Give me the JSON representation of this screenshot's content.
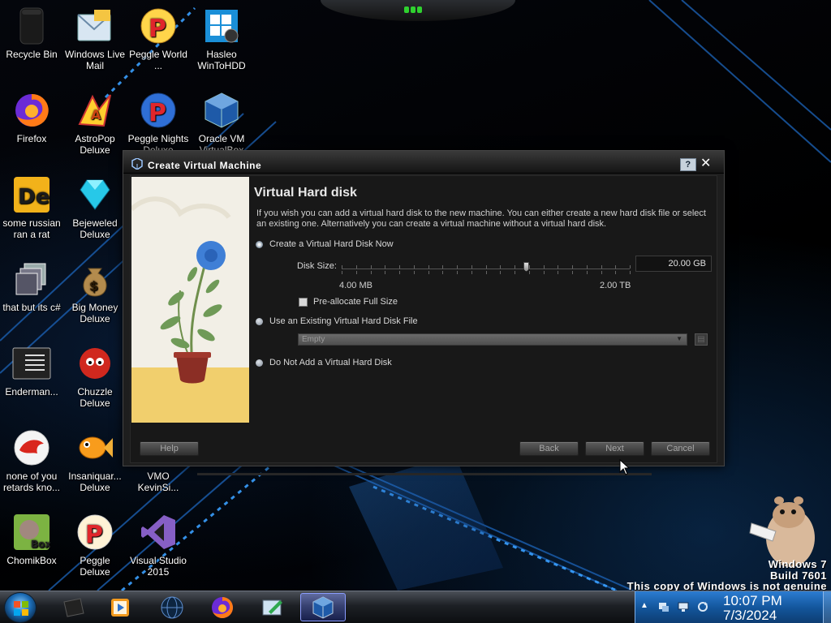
{
  "desktop": {
    "icons": [
      {
        "label": "Recycle Bin"
      },
      {
        "label": "Windows Live Mail"
      },
      {
        "label": "Peggle World ..."
      },
      {
        "label": "Hasleo WinToHDD"
      },
      {
        "label": "Firefox"
      },
      {
        "label": "AstroPop Deluxe"
      },
      {
        "label": "Peggle Nights Deluxe"
      },
      {
        "label": "Oracle VM VirtualBox"
      },
      {
        "label": "some russian ran a rat"
      },
      {
        "label": "Bejeweled Deluxe"
      },
      {
        "label": "that but its c#"
      },
      {
        "label": "Big Money Deluxe"
      },
      {
        "label": "Enderman..."
      },
      {
        "label": "Chuzzle Deluxe"
      },
      {
        "label": "none of you retards kno..."
      },
      {
        "label": "Insaniquar... Deluxe"
      },
      {
        "label": "VMO KevinSi..."
      },
      {
        "label": "ChomikBox"
      },
      {
        "label": "Peggle Deluxe"
      },
      {
        "label": "Visual Studio 2015"
      }
    ]
  },
  "dialog": {
    "title": "Create Virtual Machine",
    "help_glyph": "?",
    "close_glyph": "✕",
    "page_title": "Virtual Hard disk",
    "description": "If you wish you can add a virtual hard disk to the new machine. You can either create a new hard disk file or select an existing one. Alternatively you can create a virtual machine without a virtual hard disk.",
    "options": {
      "create_new": "Create a Virtual Hard Disk Now",
      "use_existing": "Use an Existing Virtual Hard Disk File",
      "none": "Do Not Add a Virtual Hard Disk"
    },
    "selected_option": "create_new",
    "disk_size_label": "Disk Size:",
    "disk_size_value": "20.00 GB",
    "slider_min_label": "4.00 MB",
    "slider_max_label": "2.00 TB",
    "slider_fraction": 0.64,
    "preallocate_label": "Pre-allocate Full Size",
    "preallocate_checked": false,
    "existing_file_value": "Empty",
    "buttons": {
      "help": "Help",
      "back": "Back",
      "next": "Next",
      "cancel": "Cancel"
    }
  },
  "watermark": {
    "line1": "Windows 7",
    "line2": "Build 7601",
    "line3": "This copy of Windows is not genuine"
  },
  "taskbar": {
    "pinned": [
      "app-icon",
      "media-player-icon",
      "globe-icon",
      "firefox-icon",
      "paint-icon",
      "virtualbox-icon"
    ],
    "active": "virtualbox-icon",
    "clock_time": "10:07 PM",
    "clock_date": "7/3/2024"
  }
}
